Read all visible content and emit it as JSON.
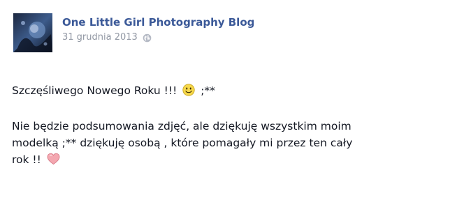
{
  "post": {
    "page_name": "One Little Girl Photography Blog",
    "date": "31 grudnia 2013",
    "privacy_icon": "globe-icon",
    "avatar_icon": "page-avatar",
    "paragraph1": {
      "text": "Szczęśliwego Nowego Roku !!!",
      "emoticon": "smiley-icon",
      "suffix": ";**"
    },
    "paragraph2": {
      "line1": "Nie będzie podsumowania zdjęć, ale dziękuję wszystkim moim",
      "line2": "modelką ;** dziękuję osobą , które pomagały mi przez ten cały",
      "line3": "rok !!",
      "emoticon": "heart-icon"
    }
  },
  "colors": {
    "link": "#3b5998",
    "meta": "#9197a3",
    "text": "#141823",
    "heart": "#f4a7b0",
    "smiley": "#f6d84a"
  }
}
